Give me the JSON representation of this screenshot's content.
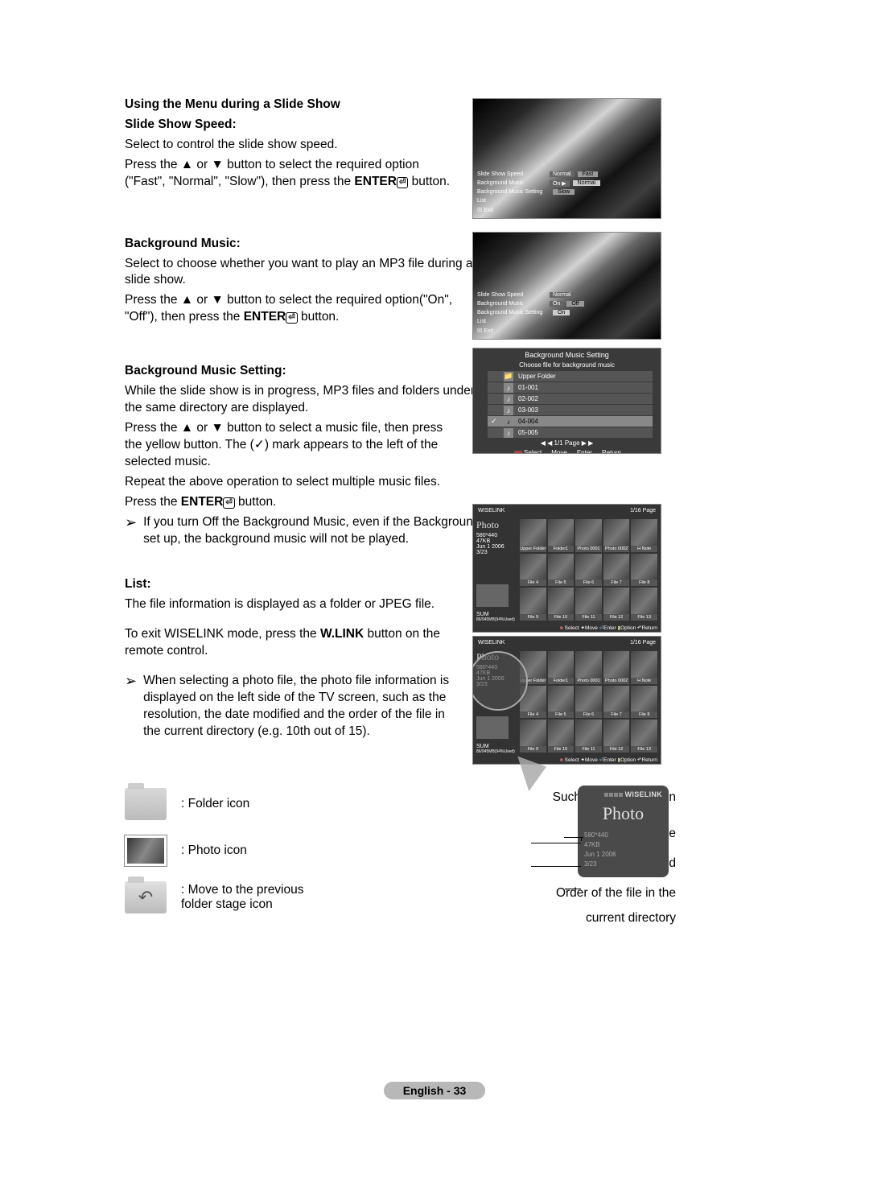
{
  "sections": {
    "title1": "Using the Menu during a Slide Show",
    "speed": {
      "heading": "Slide Show Speed:",
      "l1": "Select to control the slide show speed.",
      "l2a": "Press the ▲ or ▼ button to select the required option",
      "l2b": "(\"Fast\", \"Normal\", \"Slow\"), then press the ",
      "enter": "ENTER",
      "l2c": " button."
    },
    "bgm": {
      "heading": "Background Music:",
      "l1": "Select to choose whether you want to play an MP3 file during a slide show.",
      "l2a": "Press the ▲ or ▼ button to select the required option(\"On\", \"Off\"), then press the ",
      "enter": "ENTER",
      "l2b": " button."
    },
    "bgm_setting": {
      "heading": "Background Music Setting:",
      "l1": "While the slide show is in progress, MP3 files and folders under the same directory are displayed.",
      "l2": "Press the ▲ or ▼ button to select a music file, then press the yellow button. The (✓) mark appears to the left of the selected music.",
      "l3": "Repeat the above operation to select multiple music files.",
      "l4a": "Press the ",
      "enter": "ENTER",
      "l4b": " button.",
      "note": "If you turn Off the Background Music, even if the Background Music Settings have been set up, the background music will not be played."
    },
    "list": {
      "heading": "List:",
      "l1": "The file information is displayed as a folder or JPEG file.",
      "l2a": "To exit WISELINK mode, press the ",
      "wlink": "W.LINK",
      "l2b": " button on the remote control.",
      "note": "When selecting a photo file, the photo file information is displayed on the left side of the TV screen, such as the resolution, the date modified and the order of the file in the current directory (e.g. 10th out of 15)."
    }
  },
  "legend": {
    "folder": ": Folder icon",
    "photo": ": Photo icon",
    "prev": ": Move to the previous",
    "prev2": "  folder stage icon"
  },
  "callouts": {
    "resolution": "Such as the resolution",
    "filesize": "File Size",
    "date": "Date modified",
    "order1": "Order of the file in the",
    "order2": "current directory"
  },
  "wiselink": {
    "brand": "WISELINK",
    "photo": "Photo",
    "res": "580*440",
    "size": "47KB",
    "date": "Jun 1 2006",
    "order": "3/23"
  },
  "shot_menus": {
    "speed": {
      "r1l": "Slide Show Speed",
      "r1v": "Normal",
      "r1h": "Fast",
      "r2l": "Background Music",
      "r2v": "On ▶",
      "r2h": "Normal",
      "r3l": "Background Music Setting",
      "r3h": "Slow",
      "r4l": "List",
      "r5l": "☒ Exit"
    },
    "bgm": {
      "r1l": "Slide Show Speed",
      "r1v": "Normal",
      "r2l": "Background Music",
      "r2v": "On",
      "r2h1": "Off",
      "r3l": "Background Music Setting",
      "r3h": "On",
      "r4l": "List",
      "r5l": "☒ Exit"
    }
  },
  "bgm_dialog": {
    "title": "Background Music Setting",
    "sub": "Choose file for background music",
    "upper": "Upper Folder",
    "items": [
      "01-001",
      "02-002",
      "03-003",
      "04-004",
      "05-005"
    ],
    "page": "◀ ◀ 1/1 Page ▶ ▶",
    "select": "Select",
    "move": "Move",
    "enter": "Enter",
    "return": "Return"
  },
  "wl": {
    "brand": "WISELINK",
    "photo": "Photo",
    "meta1": "580*440",
    "meta2": "47KB",
    "meta3": "Jun 1 2006",
    "meta4": "3/23",
    "sum1": "SUM",
    "sum2": "86/945MB(94%Used)",
    "page": "1/16 Page",
    "file_hdr": "Photo 0001",
    "cells": [
      "Upper Folder",
      "Folder1",
      "Photo 0001",
      "Photo 0002",
      "H Note",
      "File 4",
      "File 5",
      "File 6",
      "File 7",
      "File 8",
      "File 9",
      "File 10",
      "File 11",
      "File 12",
      "File 13"
    ],
    "footer_select": "Select",
    "footer_move": "Move",
    "footer_enter": "Enter",
    "footer_option": "Option",
    "footer_return": "Return"
  },
  "footer": "English - 33"
}
